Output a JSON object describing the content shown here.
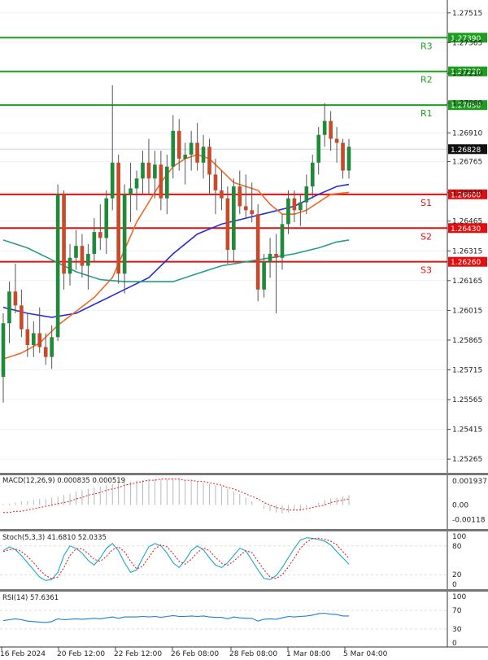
{
  "chart_data": [
    {
      "type": "candlestick",
      "x_labels": [
        "16 Feb 2024",
        "20 Feb 12:00",
        "22 Feb 12:00",
        "26 Feb 08:00",
        "28 Feb 08:00",
        "1 Mar 08:00",
        "5 Mar 04:00"
      ],
      "y_ticks": [
        "1.27515",
        "1.27365",
        "1.27210",
        "1.27060",
        "1.26910",
        "1.26765",
        "1.26610",
        "1.26465",
        "1.26315",
        "1.26165",
        "1.26015",
        "1.25865",
        "1.25715",
        "1.25565",
        "1.25415",
        "1.25265"
      ],
      "ylim": [
        1.252,
        1.2758
      ],
      "last_price": "1.26828",
      "levels": [
        {
          "name": "R3",
          "value": "1.27390",
          "color": "#1e9e1e"
        },
        {
          "name": "R2",
          "value": "1.27220",
          "color": "#1e9e1e"
        },
        {
          "name": "R1",
          "value": "1.27050",
          "color": "#1e9e1e"
        },
        {
          "name": "S1",
          "value": "1.26600",
          "color": "#e01010"
        },
        {
          "name": "S2",
          "value": "1.26430",
          "color": "#e01010"
        },
        {
          "name": "S3",
          "value": "1.26260",
          "color": "#e01010"
        }
      ],
      "candles": [
        [
          1.2568,
          1.26,
          1.2555,
          1.2595
        ],
        [
          1.2595,
          1.2616,
          1.2585,
          1.2611
        ],
        [
          1.2611,
          1.2625,
          1.26,
          1.2604
        ],
        [
          1.2604,
          1.2612,
          1.2588,
          1.2592
        ],
        [
          1.2592,
          1.26,
          1.2578,
          1.2584
        ],
        [
          1.2584,
          1.2596,
          1.2578,
          1.259
        ],
        [
          1.259,
          1.2603,
          1.258,
          1.2583
        ],
        [
          1.2583,
          1.259,
          1.2574,
          1.2578
        ],
        [
          1.2578,
          1.2594,
          1.2572,
          1.2588
        ],
        [
          1.2588,
          1.2665,
          1.2586,
          1.266
        ],
        [
          1.266,
          1.2662,
          1.2612,
          1.262
        ],
        [
          1.262,
          1.2635,
          1.2614,
          1.2628
        ],
        [
          1.2628,
          1.2642,
          1.2622,
          1.2634
        ],
        [
          1.2634,
          1.264,
          1.2618,
          1.2624
        ],
        [
          1.2624,
          1.2635,
          1.2612,
          1.263
        ],
        [
          1.263,
          1.2648,
          1.2626,
          1.2641
        ],
        [
          1.2641,
          1.2655,
          1.2632,
          1.2638
        ],
        [
          1.2638,
          1.2662,
          1.263,
          1.2658
        ],
        [
          1.2658,
          1.2715,
          1.2652,
          1.2676
        ],
        [
          1.2676,
          1.268,
          1.2615,
          1.262
        ],
        [
          1.262,
          1.2665,
          1.261,
          1.266
        ],
        [
          1.266,
          1.2676,
          1.2646,
          1.2663
        ],
        [
          1.2663,
          1.2672,
          1.2652,
          1.2668
        ],
        [
          1.2668,
          1.2682,
          1.266,
          1.2676
        ],
        [
          1.2676,
          1.2688,
          1.266,
          1.2668
        ],
        [
          1.2668,
          1.2682,
          1.2658,
          1.2675
        ],
        [
          1.2675,
          1.2682,
          1.2652,
          1.2658
        ],
        [
          1.2658,
          1.268,
          1.265,
          1.2674
        ],
        [
          1.2674,
          1.27,
          1.2668,
          1.2692
        ],
        [
          1.2692,
          1.2698,
          1.2672,
          1.2678
        ],
        [
          1.2678,
          1.2686,
          1.2665,
          1.268
        ],
        [
          1.268,
          1.2692,
          1.2672,
          1.2686
        ],
        [
          1.2686,
          1.2696,
          1.2672,
          1.2676
        ],
        [
          1.2676,
          1.269,
          1.2668,
          1.2684
        ],
        [
          1.2684,
          1.2688,
          1.266,
          1.267
        ],
        [
          1.267,
          1.2678,
          1.265,
          1.2662
        ],
        [
          1.2662,
          1.2672,
          1.2652,
          1.2658
        ],
        [
          1.2658,
          1.2664,
          1.2625,
          1.2632
        ],
        [
          1.2632,
          1.2668,
          1.2626,
          1.2664
        ],
        [
          1.2664,
          1.2672,
          1.265,
          1.2654
        ],
        [
          1.2654,
          1.267,
          1.2648,
          1.2652
        ],
        [
          1.2652,
          1.2666,
          1.2646,
          1.265
        ],
        [
          1.265,
          1.2655,
          1.2606,
          1.2612
        ],
        [
          1.2612,
          1.263,
          1.2608,
          1.2626
        ],
        [
          1.2626,
          1.2638,
          1.2618,
          1.263
        ],
        [
          1.263,
          1.264,
          1.26,
          1.2628
        ],
        [
          1.2628,
          1.265,
          1.2622,
          1.2645
        ],
        [
          1.2645,
          1.2662,
          1.264,
          1.2658
        ],
        [
          1.2658,
          1.2662,
          1.2646,
          1.2652
        ],
        [
          1.2652,
          1.266,
          1.2644,
          1.2656
        ],
        [
          1.2656,
          1.267,
          1.265,
          1.2664
        ],
        [
          1.2664,
          1.268,
          1.2658,
          1.2676
        ],
        [
          1.2676,
          1.2694,
          1.267,
          1.269
        ],
        [
          1.269,
          1.2706,
          1.2684,
          1.2697
        ],
        [
          1.2697,
          1.2702,
          1.2682,
          1.2688
        ],
        [
          1.2688,
          1.2694,
          1.2676,
          1.2686
        ],
        [
          1.2686,
          1.2688,
          1.2668,
          1.2672
        ],
        [
          1.2672,
          1.2688,
          1.2668,
          1.2684
        ]
      ],
      "series": [
        {
          "name": "",
          "color": "#2b2bd6",
          "x": [
            0,
            4,
            8,
            12,
            16,
            20,
            24,
            28,
            32,
            36,
            40,
            44,
            48,
            52,
            55,
            57
          ],
          "y": [
            1.2603,
            1.26,
            1.2598,
            1.26,
            1.2606,
            1.2612,
            1.2618,
            1.263,
            1.264,
            1.2645,
            1.2648,
            1.2651,
            1.2654,
            1.266,
            1.2664,
            1.2665
          ]
        },
        {
          "name": "",
          "color": "#f06a24",
          "x": [
            0,
            3,
            6,
            9,
            12,
            15,
            18,
            20,
            22,
            24,
            26,
            28,
            30,
            32,
            34,
            36,
            38,
            40,
            42,
            44,
            46,
            48,
            50,
            52,
            54,
            57
          ],
          "y": [
            1.2577,
            1.258,
            1.2585,
            1.2594,
            1.2601,
            1.2608,
            1.2618,
            1.2632,
            1.2646,
            1.2656,
            1.2666,
            1.2674,
            1.2678,
            1.268,
            1.2678,
            1.2672,
            1.2666,
            1.2664,
            1.2662,
            1.2655,
            1.265,
            1.265,
            1.2652,
            1.2656,
            1.266,
            1.2661
          ]
        },
        {
          "name": "",
          "color": "#2a9a8a",
          "x": [
            0,
            4,
            8,
            12,
            16,
            20,
            24,
            28,
            32,
            36,
            40,
            44,
            48,
            52,
            55,
            57
          ],
          "y": [
            1.2637,
            1.2633,
            1.2627,
            1.2621,
            1.2617,
            1.2616,
            1.2616,
            1.2616,
            1.262,
            1.2624,
            1.2626,
            1.2628,
            1.263,
            1.2633,
            1.2636,
            1.2637
          ]
        }
      ]
    },
    {
      "type": "bar",
      "title": "MACD(12,26,9) 0.000835 0.000519",
      "y_ticks": [
        "0.001937",
        "0.00",
        "-0.00118"
      ],
      "ylim": [
        -0.0018,
        0.0024
      ],
      "values": [
        0.0001,
        0.0001,
        0.0002,
        0.0003,
        0.0003,
        0.0004,
        0.0005,
        0.0005,
        0.0006,
        0.0007,
        0.0008,
        0.0009,
        0.0011,
        0.0012,
        0.0013,
        0.0014,
        0.0015,
        0.0016,
        0.0017,
        0.0018,
        0.0019,
        0.0019,
        0.002,
        0.002,
        0.0021,
        0.0021,
        0.0021,
        0.0021,
        0.0021,
        0.0021,
        0.002,
        0.002,
        0.0019,
        0.0018,
        0.0017,
        0.0016,
        0.0015,
        0.0013,
        0.0011,
        0.0009,
        0.0006,
        0.0003,
        0.0,
        -0.0003,
        -0.0005,
        -0.0006,
        -0.0007,
        -0.0006,
        -0.0005,
        -0.0004,
        -0.0002,
        0.0,
        0.0002,
        0.0004,
        0.0005,
        0.0006,
        0.0007,
        0.0008
      ],
      "series": [
        {
          "name": "",
          "color": "#e02020",
          "values": [
            -0.0006,
            -0.0006,
            -0.0005,
            -0.0005,
            -0.0004,
            -0.0003,
            -0.0002,
            -0.0001,
            0.0,
            0.0001,
            0.0002,
            0.0003,
            0.0005,
            0.0006,
            0.0008,
            0.0009,
            0.001,
            0.0012,
            0.0013,
            0.0014,
            0.0016,
            0.0017,
            0.0018,
            0.0019,
            0.002,
            0.002,
            0.0021,
            0.0021,
            0.0021,
            0.0021,
            0.002,
            0.002,
            0.0019,
            0.0019,
            0.0018,
            0.0017,
            0.0016,
            0.0014,
            0.0013,
            0.0011,
            0.0009,
            0.0007,
            0.0005,
            0.0002,
            0.0,
            -0.0002,
            -0.0003,
            -0.0004,
            -0.0004,
            -0.0004,
            -0.0003,
            -0.0002,
            -0.0001,
            0.0,
            0.0002,
            0.0003,
            0.0004,
            0.0005
          ]
        }
      ]
    },
    {
      "type": "line",
      "title": "Stoch(5,3,3) 41.6810 52.0335",
      "y_ticks": [
        "100",
        "80",
        "20",
        "0"
      ],
      "ylim": [
        0,
        100
      ],
      "series": [
        {
          "name": "",
          "color": "#1aa7c8",
          "values": [
            70,
            78,
            72,
            60,
            45,
            30,
            15,
            8,
            10,
            25,
            60,
            80,
            75,
            65,
            50,
            40,
            55,
            75,
            85,
            70,
            45,
            25,
            30,
            55,
            78,
            85,
            80,
            65,
            45,
            35,
            50,
            70,
            80,
            72,
            55,
            40,
            35,
            45,
            60,
            75,
            70,
            50,
            30,
            12,
            10,
            18,
            35,
            55,
            75,
            92,
            97,
            96,
            93,
            90,
            82,
            68,
            55,
            42
          ]
        },
        {
          "name": "",
          "color": "#e02020",
          "values": [
            68,
            72,
            74,
            68,
            58,
            45,
            30,
            18,
            12,
            15,
            35,
            60,
            74,
            74,
            64,
            52,
            48,
            58,
            72,
            78,
            68,
            48,
            32,
            38,
            56,
            74,
            82,
            78,
            64,
            48,
            42,
            52,
            66,
            76,
            70,
            56,
            44,
            40,
            48,
            60,
            70,
            66,
            48,
            30,
            15,
            12,
            20,
            36,
            55,
            75,
            88,
            95,
            96,
            94,
            90,
            82,
            68,
            54
          ]
        }
      ]
    },
    {
      "type": "line",
      "title": "RSI(14) 57.6361",
      "y_ticks": [
        "100",
        "70",
        "30",
        "0"
      ],
      "ylim": [
        0,
        100
      ],
      "series": [
        {
          "name": "",
          "color": "#1e7fd6",
          "values": [
            48,
            50,
            52,
            50,
            47,
            46,
            45,
            44,
            46,
            52,
            50,
            51,
            52,
            51,
            52,
            53,
            52,
            54,
            56,
            53,
            56,
            56,
            56,
            57,
            56,
            57,
            55,
            57,
            59,
            57,
            57,
            58,
            57,
            58,
            56,
            55,
            55,
            52,
            56,
            54,
            53,
            53,
            47,
            51,
            52,
            51,
            54,
            57,
            56,
            57,
            58,
            60,
            63,
            64,
            62,
            61,
            58,
            58
          ]
        }
      ]
    }
  ]
}
